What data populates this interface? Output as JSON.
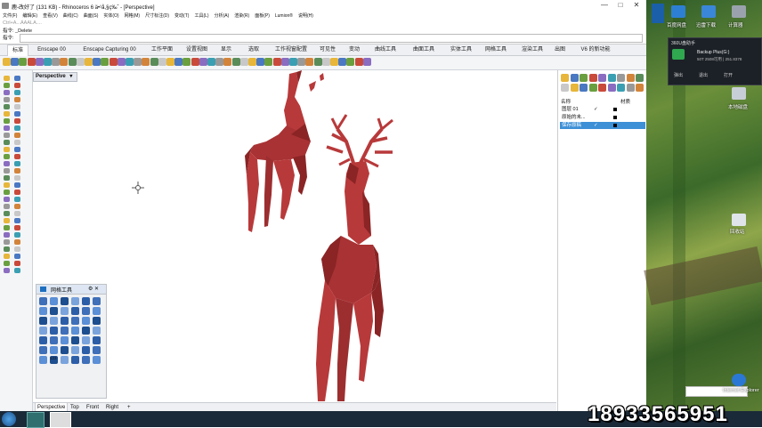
{
  "window": {
    "title": "鹿-改好了 (131 KB) - Rhinoceros 6 ä•¹å,§ç‰ˆ - [Perspective]",
    "min": "—",
    "max": "□",
    "close": "✕"
  },
  "menu": [
    "文件(F)",
    "编辑(E)",
    "查看(V)",
    "曲线(C)",
    "曲面(S)",
    "实体(O)",
    "网格(M)",
    "尺寸标注(D)",
    "变动(T)",
    "工具(L)",
    "分析(A)",
    "渲染(R)",
    "面板(P)",
    "Lumion®",
    "说明(H)"
  ],
  "command": {
    "line1": "指令: _Delete",
    "line2": "指令:",
    "faded": "Ctrl+A...ÁAALA...."
  },
  "toolbar_tabs": [
    "标准",
    "Enscape 00",
    "Enscape Capturing 00",
    "工作平面",
    "设置视图",
    "显示",
    "选取",
    "工作视窗配置",
    "可见性",
    "变动",
    "曲线工具",
    "曲面工具",
    "实体工具",
    "网格工具",
    "渲染工具",
    "出图",
    "V6 的新功能"
  ],
  "viewport": {
    "label": "Perspective",
    "dropdown": "▾"
  },
  "bottom_tabs": [
    "Perspective",
    "Top",
    "Front",
    "Right",
    "+"
  ],
  "mesh_panel": {
    "title": "网格工具",
    "controls": "⚙ ✕",
    "label_123": "123"
  },
  "layers": {
    "col_name": "名称",
    "col_material": "材质",
    "rows": [
      {
        "name": "图层 01",
        "check": "✓"
      },
      {
        "name": "原始的未...",
        "check": ""
      },
      {
        "name": "保存原稿",
        "check": "✓"
      }
    ]
  },
  "desktop": {
    "icons": [
      {
        "label": "百度网盘"
      },
      {
        "label": "迅雷下载"
      },
      {
        "label": "计算器"
      },
      {
        "label": "本地磁盘"
      },
      {
        "label": "回收站"
      },
      {
        "label": "Internet Explorer"
      }
    ],
    "notify": {
      "title": "360U盘助手",
      "line1": "Backup Plus(G:)",
      "line2": "50T 2508可用 | 251.8378",
      "links": [
        "弹出",
        "退出",
        "打开"
      ]
    }
  },
  "watermark_phone": "18933565951",
  "colors": {
    "deer": "#b8393a",
    "deer_dark": "#8a2425",
    "selected_row": "#3d8fd6",
    "taskbar": "#1b2a38"
  }
}
